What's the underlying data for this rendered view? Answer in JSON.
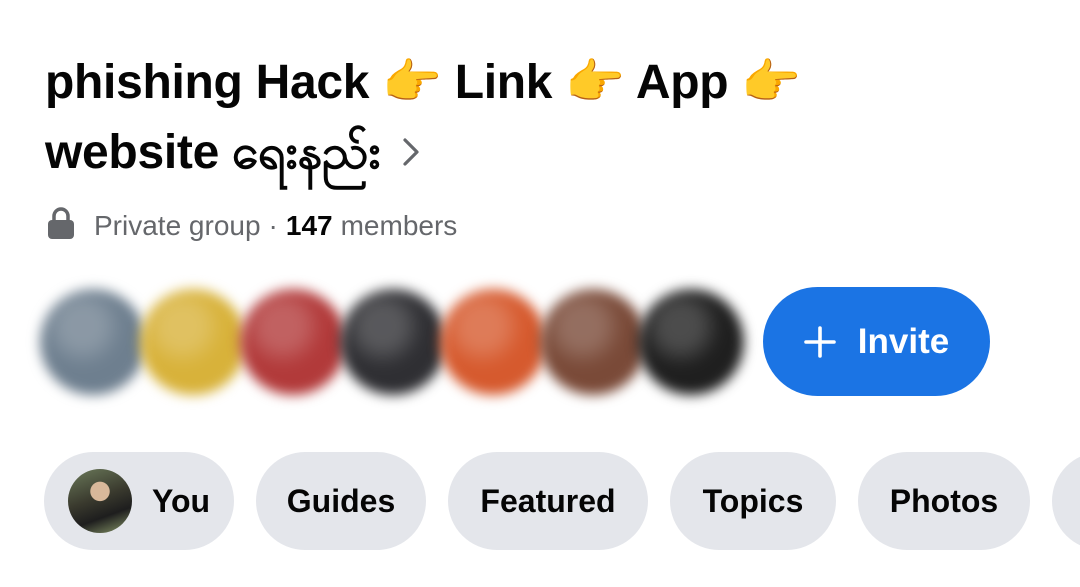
{
  "group": {
    "name_line1": "phishing Hack 👉 Link 👉 App 👉",
    "name_line2": "website ရေးနည်း",
    "privacy": "Private group",
    "separator": "·",
    "member_count": "147",
    "members_word": "members"
  },
  "avatars": [
    {
      "name": "member-avatar-1",
      "color": "#6e7f8f"
    },
    {
      "name": "member-avatar-2",
      "color": "#d8b23a"
    },
    {
      "name": "member-avatar-3",
      "color": "#b23a3a"
    },
    {
      "name": "member-avatar-4",
      "color": "#2f2f33"
    },
    {
      "name": "member-avatar-5",
      "color": "#d65a2e"
    },
    {
      "name": "member-avatar-6",
      "color": "#7a4a38"
    },
    {
      "name": "member-avatar-7",
      "color": "#1f1f1f"
    }
  ],
  "invite": {
    "label": "Invite",
    "color": "#1b74e4"
  },
  "tabs": [
    {
      "label": "You"
    },
    {
      "label": "Guides"
    },
    {
      "label": "Featured"
    },
    {
      "label": "Topics"
    },
    {
      "label": "Photos"
    }
  ],
  "icons": {
    "privacy": "lock-icon",
    "title_chevron": "chevron-right-icon",
    "invite": "plus-icon"
  }
}
